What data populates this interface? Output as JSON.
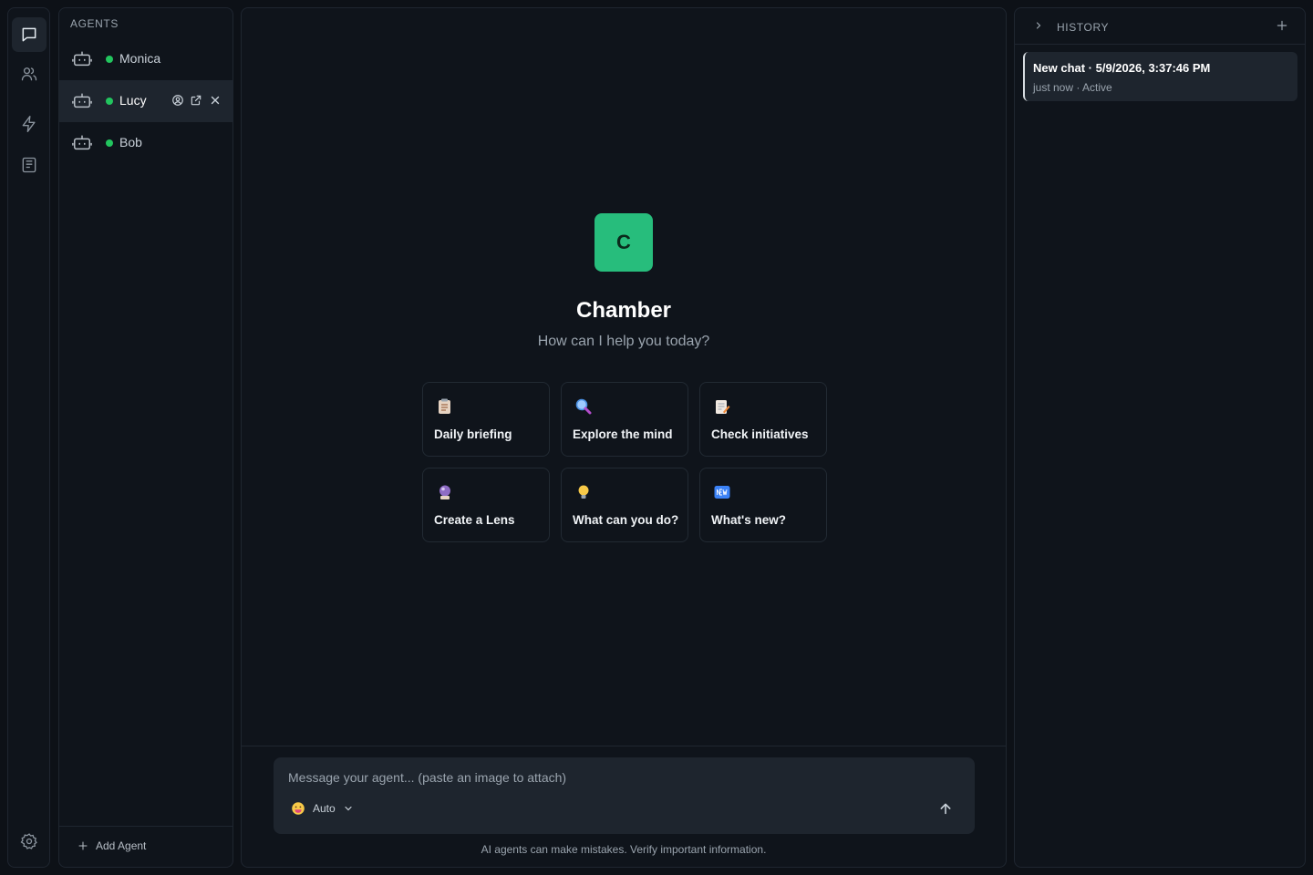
{
  "agents": {
    "title": "AGENTS",
    "items": [
      {
        "name": "Monica",
        "status_color": "#22c55e"
      },
      {
        "name": "Lucy",
        "status_color": "#22c55e"
      },
      {
        "name": "Bob",
        "status_color": "#22c55e"
      }
    ],
    "add_label": "Add Agent"
  },
  "main": {
    "logo_letter": "C",
    "title": "Chamber",
    "subtitle": "How can I help you today?",
    "cards": [
      {
        "label": "Daily briefing",
        "icon": "clipboard-icon"
      },
      {
        "label": "Explore the mind",
        "icon": "magnifier-icon"
      },
      {
        "label": "Check initiatives",
        "icon": "memo-icon"
      },
      {
        "label": "Create a Lens",
        "icon": "crystal-ball-icon"
      },
      {
        "label": "What can you do?",
        "icon": "lightbulb-icon"
      },
      {
        "label": "What's new?",
        "icon": "new-badge-icon"
      }
    ],
    "composer": {
      "placeholder": "Message your agent... (paste an image to attach)",
      "model": "Auto"
    },
    "disclaimer": "AI agents can make mistakes. Verify important information."
  },
  "history": {
    "title": "HISTORY",
    "items": [
      {
        "title": "New chat · 5/9/2026, 3:37:46 PM",
        "meta": "just now · Active"
      }
    ]
  },
  "colors": {
    "accent": "#27bd7c",
    "status_online": "#22c55e",
    "background": "#0d1117",
    "panel": "#0f141b"
  }
}
